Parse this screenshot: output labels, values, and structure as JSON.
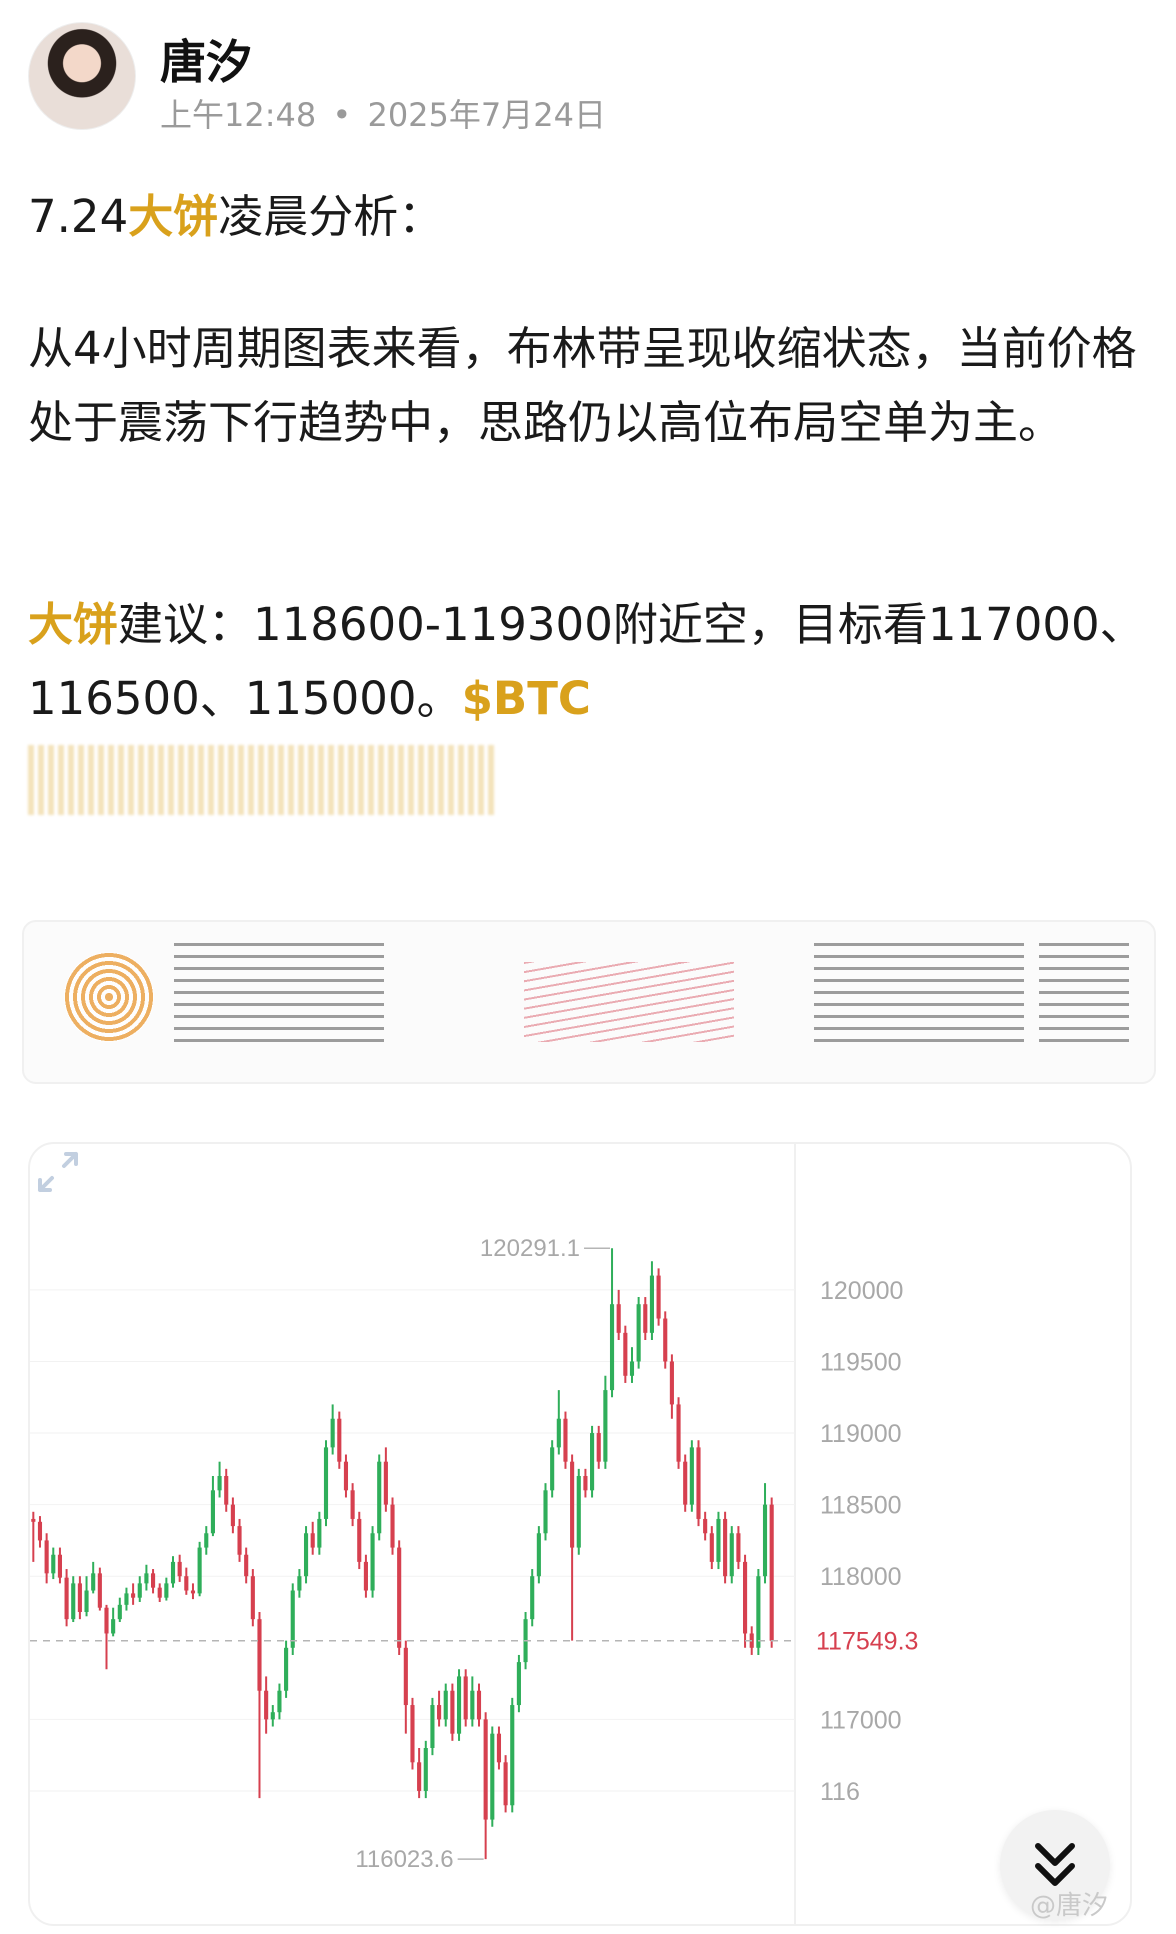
{
  "post": {
    "author": "唐汐",
    "time": "上午12:48",
    "dot": "•",
    "date": "2025年7月24日"
  },
  "content": {
    "p1_prefix": "7.24",
    "p1_highlight": "大饼",
    "p1_suffix": "凌晨分析：",
    "p2": "从4小时周期图表来看，布林带呈现收缩状态，当前价格处于震荡下行趋势中，思路仍以高位布局空单为主。",
    "p3_highlight": "大饼",
    "p3_text": "建议：118600-119300附近空，目标看117000、116500、115000。",
    "cashtag": "$BTC"
  },
  "watermark": "@唐汐",
  "colors": {
    "highlight": "#d9a11c",
    "candle_up": "#2fae5a",
    "candle_down": "#d6404f",
    "grid": "#f2f2f2",
    "axis_text": "#a8a8a8",
    "current_price_text": "#d6404f"
  },
  "icons": {
    "expand": "expand-diagonal-icon",
    "scroll_down": "double-chevron-down-icon"
  },
  "chart_data": {
    "type": "candlestick",
    "y_ticks": [
      120000,
      119500,
      119000,
      118500,
      118000,
      117000,
      116500
    ],
    "y_tick_labels": [
      "120000",
      "119500",
      "119000",
      "118500",
      "118000",
      "117000",
      "116"
    ],
    "ylim": [
      115850,
      120600
    ],
    "high_label": "120291.1",
    "low_label": "116023.6",
    "current_price_label": "117549.3",
    "current_price": 117549.3,
    "candles": [
      [
        118400,
        118380,
        118450,
        118100
      ],
      [
        118380,
        118250,
        118420,
        118200
      ],
      [
        118250,
        118020,
        118300,
        117950
      ],
      [
        118020,
        118150,
        118200,
        117980
      ],
      [
        118150,
        117990,
        118200,
        117950
      ],
      [
        117990,
        117700,
        118050,
        117650
      ],
      [
        117700,
        117950,
        118000,
        117680
      ],
      [
        117950,
        117750,
        118000,
        117700
      ],
      [
        117750,
        117900,
        118000,
        117720
      ],
      [
        117900,
        118020,
        118100,
        117880
      ],
      [
        118020,
        117780,
        118060,
        117760
      ],
      [
        117780,
        117600,
        117800,
        117350
      ],
      [
        117600,
        117700,
        117780,
        117580
      ],
      [
        117700,
        117800,
        117850,
        117680
      ],
      [
        117800,
        117880,
        117920,
        117760
      ],
      [
        117880,
        117850,
        117950,
        117800
      ],
      [
        117850,
        117950,
        118000,
        117820
      ],
      [
        117950,
        118020,
        118080,
        117900
      ],
      [
        118020,
        117920,
        118050,
        117880
      ],
      [
        117920,
        117850,
        117950,
        117820
      ],
      [
        117850,
        117950,
        117990,
        117830
      ],
      [
        117950,
        118100,
        118140,
        117920
      ],
      [
        118100,
        118000,
        118150,
        117960
      ],
      [
        118000,
        117900,
        118060,
        117870
      ],
      [
        117900,
        117880,
        117950,
        117840
      ],
      [
        117880,
        118200,
        118240,
        117860
      ],
      [
        118200,
        118300,
        118350,
        118150
      ],
      [
        118300,
        118600,
        118700,
        118280
      ],
      [
        118600,
        118700,
        118800,
        118550
      ],
      [
        118700,
        118500,
        118750,
        118450
      ],
      [
        118500,
        118350,
        118550,
        118300
      ],
      [
        118350,
        118150,
        118400,
        118100
      ],
      [
        118150,
        118000,
        118200,
        117950
      ],
      [
        118000,
        117700,
        118050,
        117650
      ],
      [
        117700,
        117200,
        117750,
        116450
      ],
      [
        117200,
        117000,
        117300,
        116900
      ],
      [
        117000,
        117050,
        117100,
        116950
      ],
      [
        117050,
        117200,
        117250,
        117000
      ],
      [
        117200,
        117500,
        117550,
        117150
      ],
      [
        117500,
        117900,
        117950,
        117450
      ],
      [
        117900,
        118000,
        118050,
        117850
      ],
      [
        118000,
        118300,
        118350,
        117950
      ],
      [
        118300,
        118200,
        118380,
        118150
      ],
      [
        118200,
        118400,
        118450,
        118150
      ],
      [
        118400,
        118900,
        118950,
        118350
      ],
      [
        118900,
        119100,
        119200,
        118850
      ],
      [
        119100,
        118800,
        119150,
        118750
      ],
      [
        118800,
        118600,
        118850,
        118550
      ],
      [
        118600,
        118400,
        118650,
        118350
      ],
      [
        118400,
        118100,
        118450,
        118050
      ],
      [
        118100,
        117900,
        118150,
        117850
      ],
      [
        117900,
        118300,
        118350,
        117850
      ],
      [
        118300,
        118800,
        118850,
        118250
      ],
      [
        118800,
        118500,
        118900,
        118450
      ],
      [
        118500,
        118200,
        118550,
        118150
      ],
      [
        118200,
        117500,
        118250,
        117450
      ],
      [
        117500,
        117100,
        117550,
        116900
      ],
      [
        117100,
        116700,
        117150,
        116650
      ],
      [
        116700,
        116500,
        116800,
        116450
      ],
      [
        116500,
        116800,
        116850,
        116450
      ],
      [
        116800,
        117100,
        117150,
        116750
      ],
      [
        117100,
        117000,
        117200,
        116950
      ],
      [
        117000,
        117200,
        117250,
        116950
      ],
      [
        117200,
        116900,
        117250,
        116850
      ],
      [
        116900,
        117300,
        117350,
        116850
      ],
      [
        117300,
        117000,
        117350,
        116950
      ],
      [
        117000,
        117200,
        117300,
        116950
      ],
      [
        117200,
        117000,
        117250,
        116950
      ],
      [
        117000,
        116300,
        117050,
        116023.6
      ],
      [
        116300,
        116900,
        116950,
        116250
      ],
      [
        116900,
        116700,
        116950,
        116650
      ],
      [
        116700,
        116400,
        116750,
        116350
      ],
      [
        116400,
        117100,
        117150,
        116350
      ],
      [
        117100,
        117400,
        117450,
        117050
      ],
      [
        117400,
        117700,
        117750,
        117350
      ],
      [
        117700,
        118000,
        118050,
        117650
      ],
      [
        118000,
        118300,
        118350,
        117950
      ],
      [
        118300,
        118600,
        118650,
        118250
      ],
      [
        118600,
        118900,
        118950,
        118550
      ],
      [
        118900,
        119100,
        119300,
        118850
      ],
      [
        119100,
        118800,
        119150,
        118750
      ],
      [
        118800,
        118200,
        118850,
        117550
      ],
      [
        118200,
        118700,
        118750,
        118150
      ],
      [
        118700,
        118600,
        118750,
        118550
      ],
      [
        118600,
        119000,
        119050,
        118550
      ],
      [
        119000,
        118800,
        119050,
        118750
      ],
      [
        118800,
        119300,
        119400,
        118750
      ],
      [
        119300,
        119900,
        120291.1,
        119250
      ],
      [
        119900,
        119700,
        120000,
        119650
      ],
      [
        119700,
        119400,
        119750,
        119350
      ],
      [
        119400,
        119500,
        119600,
        119350
      ],
      [
        119500,
        119900,
        119950,
        119450
      ],
      [
        119900,
        119700,
        119950,
        119650
      ],
      [
        119700,
        120100,
        120200,
        119650
      ],
      [
        120100,
        119800,
        120150,
        119750
      ],
      [
        119800,
        119500,
        119850,
        119450
      ],
      [
        119500,
        119200,
        119550,
        119100
      ],
      [
        119200,
        118800,
        119250,
        118750
      ],
      [
        118800,
        118500,
        118850,
        118450
      ],
      [
        118500,
        118900,
        118950,
        118450
      ],
      [
        118900,
        118400,
        118950,
        118350
      ],
      [
        118400,
        118300,
        118450,
        118250
      ],
      [
        118300,
        118100,
        118350,
        118050
      ],
      [
        118100,
        118400,
        118450,
        118050
      ],
      [
        118400,
        118000,
        118450,
        117950
      ],
      [
        118000,
        118300,
        118350,
        117950
      ],
      [
        118300,
        118100,
        118350,
        118050
      ],
      [
        118100,
        117600,
        118150,
        117500
      ],
      [
        117600,
        117500,
        117650,
        117450
      ],
      [
        117500,
        118000,
        118050,
        117450
      ],
      [
        118000,
        118500,
        118650,
        117950
      ],
      [
        118500,
        117549.3,
        118550,
        117500
      ]
    ]
  }
}
